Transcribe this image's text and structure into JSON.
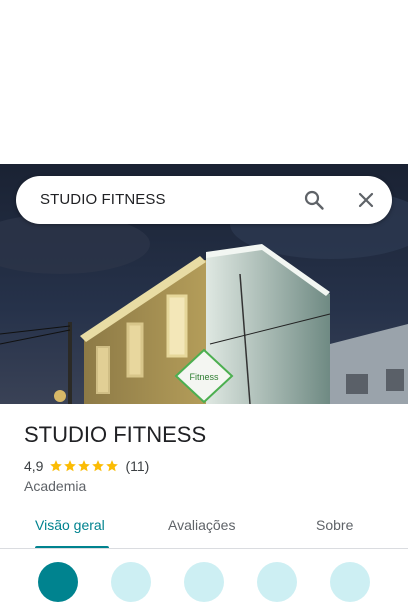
{
  "search": {
    "query": "STUDIO FITNESS"
  },
  "place": {
    "name": "STUDIO FITNESS",
    "rating": "4,9",
    "review_count": "(11)",
    "category": "Academia",
    "stars": 5
  },
  "tabs": [
    {
      "label": "Visão geral",
      "active": true
    },
    {
      "label": "Avaliações",
      "active": false
    },
    {
      "label": "Sobre",
      "active": false
    }
  ],
  "photo": {
    "sign_text": "Fitness"
  },
  "colors": {
    "accent": "#00838f",
    "star": "#fbbc04",
    "action_primary": "#00838f",
    "action_secondary": "#cdeff3"
  }
}
